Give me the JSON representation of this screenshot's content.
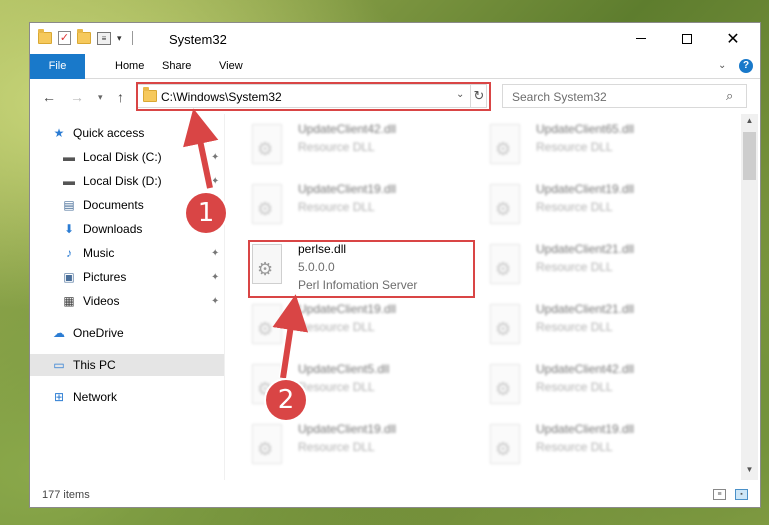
{
  "window": {
    "title": "System32",
    "controls": {
      "minimize": "—",
      "maximize": "",
      "close": "✕"
    }
  },
  "qat": {
    "arrow": "▾"
  },
  "ribbon": {
    "tabs": [
      "File",
      "Home",
      "Share",
      "View"
    ],
    "chevron": "⌄",
    "help": "?"
  },
  "nav": {
    "back": "←",
    "forward": "→",
    "recent": "▾",
    "up": "↑",
    "address": "C:\\Windows\\System32",
    "address_dropdown": "⌄",
    "refresh": "↻",
    "search_placeholder": "Search System32",
    "search_icon": "⌕"
  },
  "sidebar": {
    "items": [
      {
        "label": "Quick access",
        "icon": "star-icon",
        "glyph": "★",
        "color": "#2b7cd3"
      },
      {
        "label": "Local Disk (C:)",
        "icon": "drive-icon",
        "glyph": "▬",
        "color": "#555555",
        "pinned": true
      },
      {
        "label": "Local Disk (D:)",
        "icon": "drive-icon",
        "glyph": "▬",
        "color": "#555555",
        "pinned": true
      },
      {
        "label": "Documents",
        "icon": "documents-icon",
        "glyph": "▤",
        "color": "#4a6f9a",
        "pinned": true
      },
      {
        "label": "Downloads",
        "icon": "downloads-icon",
        "glyph": "⬇",
        "color": "#2b7cd3",
        "pinned": true
      },
      {
        "label": "Music",
        "icon": "music-icon",
        "glyph": "♪",
        "color": "#2b7cd3",
        "pinned": true
      },
      {
        "label": "Pictures",
        "icon": "pictures-icon",
        "glyph": "▣",
        "color": "#4a6f9a",
        "pinned": true
      },
      {
        "label": "Videos",
        "icon": "videos-icon",
        "glyph": "▦",
        "color": "#444444",
        "pinned": true
      },
      {
        "label": "OneDrive",
        "icon": "onedrive-icon",
        "glyph": "☁",
        "color": "#2b7cd3"
      },
      {
        "label": "This PC",
        "icon": "this-pc-icon",
        "glyph": "▭",
        "color": "#2b7cd3",
        "selected": true
      },
      {
        "label": "Network",
        "icon": "network-icon",
        "glyph": "⊞",
        "color": "#2b7cd3"
      }
    ],
    "pin_glyph": "📌"
  },
  "files": {
    "left": [
      {
        "name": "UpdateClient42.dll",
        "line2": "Resource DLL"
      },
      {
        "name": "UpdateClient19.dll",
        "line2": "Resource DLL"
      },
      {
        "name": "perlse.dll",
        "line2": "5.0.0.0",
        "line3": "Perl Infomation Server",
        "highlighted": true
      },
      {
        "name": "UpdateClient19.dll",
        "line2": "Resource DLL"
      },
      {
        "name": "UpdateClient5.dll",
        "line2": "Resource DLL"
      },
      {
        "name": "UpdateClient19.dll",
        "line2": "Resource DLL"
      }
    ],
    "right": [
      {
        "name": "UpdateClient65.dll",
        "line2": "Resource DLL"
      },
      {
        "name": "UpdateClient19.dll",
        "line2": "Resource DLL"
      },
      {
        "name": "UpdateClient21.dll",
        "line2": "Resource DLL"
      },
      {
        "name": "UpdateClient21.dll",
        "line2": "Resource DLL"
      },
      {
        "name": "UpdateClient42.dll",
        "line2": "Resource DLL"
      },
      {
        "name": "UpdateClient19.dll",
        "line2": "Resource DLL"
      }
    ],
    "gear_glyph": "⚙"
  },
  "status": {
    "count": "177 items"
  },
  "annotations": {
    "badge1": "1",
    "badge2": "2",
    "color": "#d94545"
  }
}
